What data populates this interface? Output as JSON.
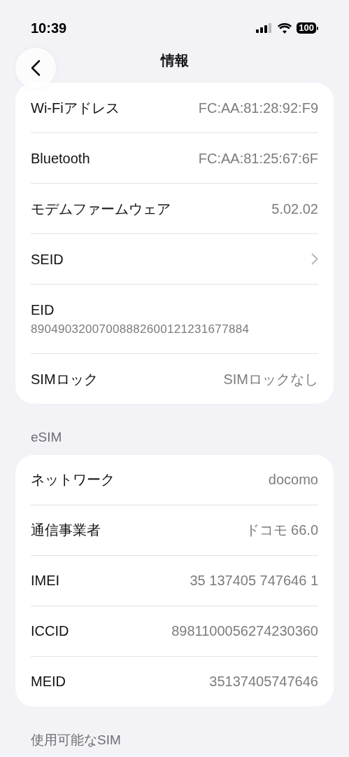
{
  "status_bar": {
    "time": "10:39",
    "battery": "100"
  },
  "nav": {
    "title": "情報"
  },
  "sections": [
    {
      "rows": [
        {
          "kind": "value",
          "label": "Wi-Fiアドレス",
          "value": "FC:AA:81:28:92:F9"
        },
        {
          "kind": "value",
          "label": "Bluetooth",
          "value": "FC:AA:81:25:67:6F"
        },
        {
          "kind": "value",
          "label": "モデムファームウェア",
          "value": "5.02.02"
        },
        {
          "kind": "chevron",
          "label": "SEID"
        },
        {
          "kind": "stacked",
          "label": "EID",
          "value": "89049032007008882600121231677884"
        },
        {
          "kind": "value",
          "label": "SIMロック",
          "value": "SIMロックなし"
        }
      ]
    },
    {
      "header": "eSIM",
      "rows": [
        {
          "kind": "value",
          "label": "ネットワーク",
          "value": "docomo"
        },
        {
          "kind": "value",
          "label": "通信事業者",
          "value": "ドコモ 66.0"
        },
        {
          "kind": "value",
          "label": "IMEI",
          "value": "35 137405 747646 1"
        },
        {
          "kind": "value",
          "label": "ICCID",
          "value": "8981100056274230360"
        },
        {
          "kind": "value",
          "label": "MEID",
          "value": "35137405747646"
        }
      ]
    },
    {
      "header": "使用可能なSIM"
    }
  ]
}
